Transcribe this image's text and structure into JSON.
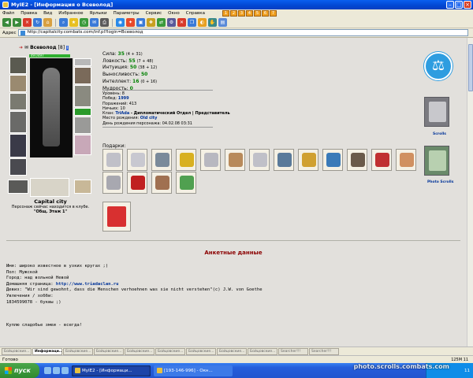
{
  "window": {
    "title": "MyIE2 - [Информация о Всеволод]"
  },
  "menu": [
    "Файл",
    "Правка",
    "Вид",
    "Избранное",
    "Ярлыки",
    "Параметры",
    "Сервис",
    "Окно",
    "Справка"
  ],
  "address": {
    "label": "Адрес",
    "url": "http://capitalcity.combats.com/inf.pl?login=Всеволод"
  },
  "character": {
    "name": "Всеволод",
    "level": "[8]",
    "hp": "497/497",
    "city": "Capital city",
    "status_line": "Персонаж сейчас находится в клубе.",
    "location": "\"Общ. Этаж 1\""
  },
  "stats": [
    {
      "label": "Сила:",
      "value": "35",
      "extra": "(4 + 31)"
    },
    {
      "label": "Ловкость:",
      "value": "55",
      "extra": "(7 + 48)"
    },
    {
      "label": "Интуиция:",
      "value": "50",
      "extra": "(38 + 12)"
    },
    {
      "label": "Выносливость:",
      "value": "50",
      "extra": ""
    },
    {
      "label": "Интеллект:",
      "value": "16",
      "extra": "(0 + 16)"
    },
    {
      "label": "Мудрость:",
      "value": "0",
      "extra": ""
    }
  ],
  "info": {
    "level_label": "Уровень:",
    "level_value": "8",
    "wins_label": "Побед:",
    "wins_value": "1999",
    "losses_label": "Поражений:",
    "losses_value": "413",
    "draws_label": "Ничьих:",
    "draws_value": "10",
    "clan_label": "Клан:",
    "clan_value": "TriAda",
    "clan_dept": "- Дипломатический Отдел | Представитель",
    "birthplace_label": "Место рождения:",
    "birthplace_value": "Old city",
    "birthday_label": "День рождения персонажа:",
    "birthday_value": "04.02.08 03:31"
  },
  "gifts": {
    "label": "Подарки:",
    "row1_colors": [
      "#c0c0c8",
      "#c8c8d0",
      "#7a8a9a",
      "#d8b020",
      "#b8b8c0",
      "#b88a5a",
      "#c0c0c8",
      "#5a7a9a",
      "#d0a030",
      "#3a7ab8",
      "#6a5a4a",
      "#c03030",
      "#d09060"
    ],
    "row2_colors": [
      "#a8a8b0",
      "#c02020",
      "#a07050",
      "#50a050"
    ],
    "big_color": "#d83030"
  },
  "sidebar": {
    "scrolls_caption": "Scrolls",
    "photo_scrolls_caption": "Photo Scrolls"
  },
  "profile": {
    "title": "Анкетные данные",
    "name_line": "Имя: широко известное в узких кругах ;)",
    "gender_line": "Пол: Мужской",
    "city_line": "Город: над вольной Невой",
    "homepage_label": "Домашняя страница:",
    "homepage_value": "http://www.triadaclan.ru",
    "motto_line": "Девиз: \"Wir sind gewohnt, dass die Menschen verhoehnen was sie nicht verstehen\"(c) J.W. von Goethe",
    "hobby_line": "Увлечения / хобби:",
    "icq_line": "1834599078 - буквы ;)",
    "quote_line": "Куплю сладобье змеи - всегда!"
  },
  "page_tabs": [
    "Бойцовские...",
    "Информаци...",
    "Бойцовские...",
    "Бойцовские...",
    "Бойцовские...",
    "Бойцовские...",
    "Бойцовские...",
    "Бойцовские...",
    "Бойцовские...",
    "Searcher!!!",
    "Searcher!!!"
  ],
  "status": {
    "text": "Готово",
    "zoom": "125M 11"
  },
  "taskbar": {
    "start": "пуск",
    "tasks": [
      "MyIE2 - [Информаци...",
      "[193-146-996] - Окн..."
    ],
    "clock": "11",
    "watermark": "photo.scrolls.combats.com"
  }
}
